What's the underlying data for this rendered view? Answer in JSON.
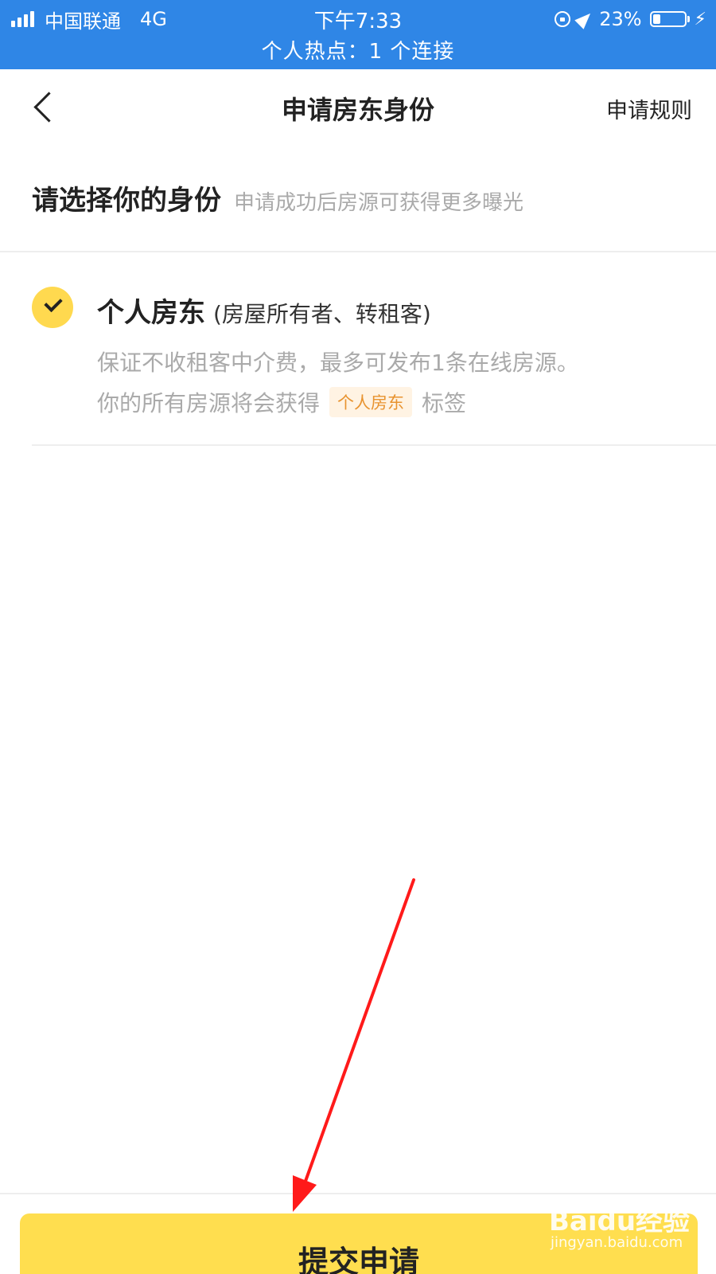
{
  "status_bar": {
    "carrier": "中国联通",
    "network": "4G",
    "time": "下午7:33",
    "battery_percent": "23%",
    "battery_level": 0.23,
    "hotspot": "个人热点：1 个连接",
    "bg_color": "#2f86e6"
  },
  "nav": {
    "title": "申请房东身份",
    "rules_label": "申请规则"
  },
  "section": {
    "title": "请选择你的身份",
    "subtitle": "申请成功后房源可获得更多曝光"
  },
  "option": {
    "selected": true,
    "title": "个人房东",
    "subtitle": "(房屋所有者、转租客)",
    "desc_line1": "保证不收租客中介费，最多可发布1条在线房源。",
    "desc_line2_prefix": "你的所有房源将会获得",
    "tag": "个人房东",
    "desc_line2_suffix": "标签"
  },
  "submit": {
    "label": "提交申请",
    "color": "#ffde4f"
  },
  "watermark": {
    "logo": "Baidu经验",
    "url": "jingyan.baidu.com"
  },
  "icons": [
    "signal-icon",
    "rotation-lock-icon",
    "location-icon",
    "battery-icon",
    "charging-icon",
    "back-icon",
    "check-icon",
    "arrow-annotation"
  ]
}
